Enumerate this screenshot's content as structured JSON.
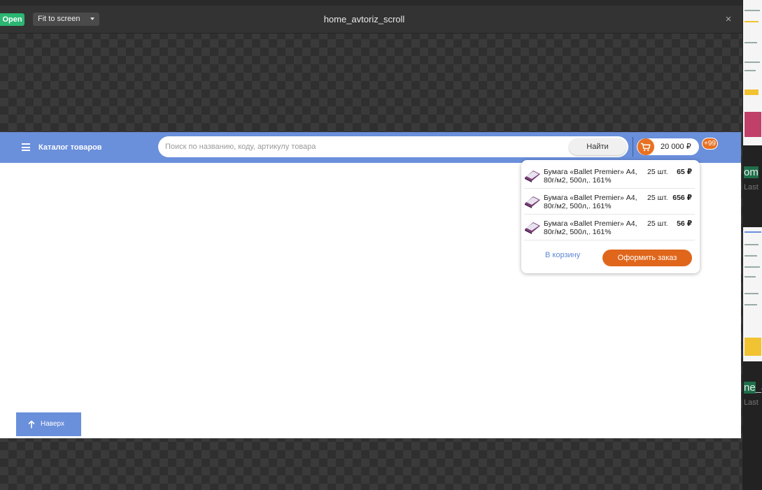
{
  "viewer": {
    "open_label": "Open",
    "fit_select_value": "Fit to screen",
    "title": "home_avtoriz_scroll",
    "close_glyph": "×"
  },
  "side_panel": {
    "label1_highlight": "om",
    "sub1": "Last",
    "label2_highlight": "ne",
    "label2_rest": "_a",
    "sub2": "Last"
  },
  "header": {
    "catalog_label": "Каталог товаров",
    "search_placeholder": "Поиск по названию, коду, артикулу товара",
    "search_button": "Найти",
    "cart_total": "20 000 ₽",
    "cart_badge": "+99"
  },
  "cart_dropdown": {
    "items": [
      {
        "name": "Бумага «Ballet Premier» А4, 80г/м2, 500л,. 161%",
        "qty": "25 шт.",
        "price": "65 ₽"
      },
      {
        "name": "Бумага «Ballet Premier» А4, 80г/м2, 500л,. 161%",
        "qty": "25 шт.",
        "price": "656 ₽"
      },
      {
        "name": "Бумага «Ballet Premier» А4, 80г/м2, 500л,. 161%",
        "qty": "25 шт.",
        "price": "56 ₽"
      }
    ],
    "to_cart_link": "В корзину",
    "checkout_button": "Оформить заказ"
  },
  "up_button": {
    "label": "Наверх"
  },
  "colors": {
    "header_blue": "#6a8fdb",
    "accent_orange": "#e87123",
    "open_green": "#2bb673"
  }
}
